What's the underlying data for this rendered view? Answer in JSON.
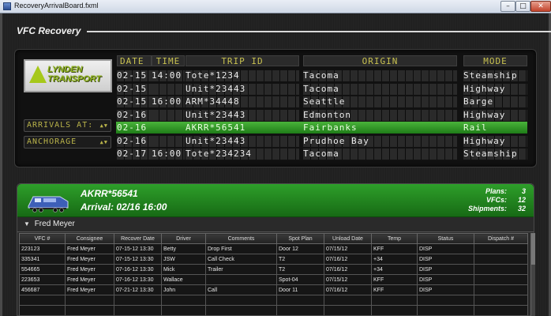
{
  "window": {
    "title": "RecoveryArrivalBoard.fxml",
    "minimize_glyph": "–",
    "maximize_glyph": "□",
    "close_glyph": "✕"
  },
  "app": {
    "title": "VFC Recovery"
  },
  "logo": {
    "line1": "LYNDEN",
    "line2": "TRANSPORT"
  },
  "selectors": {
    "mode_label": "ARRIVALS AT:",
    "location": "ANCHORAGE",
    "arrow_glyph": "▲▼"
  },
  "board": {
    "headers": {
      "date": "DATE",
      "time": "TIME",
      "trip": "TRIP ID",
      "origin": "ORIGIN",
      "mode": "MODE"
    },
    "selected_row_index": 4,
    "rows": [
      {
        "date": "02-15",
        "time": "14:00",
        "trip": "Tote*1234",
        "origin": "Tacoma",
        "mode": "Steamship"
      },
      {
        "date": "02-15",
        "time": "",
        "trip": "Unit*23443",
        "origin": "Tacoma",
        "mode": "Highway"
      },
      {
        "date": "02-15",
        "time": "16:00",
        "trip": "ARM*34448",
        "origin": "Seattle",
        "mode": "Barge"
      },
      {
        "date": "02-16",
        "time": "",
        "trip": "Unit*23443",
        "origin": "Edmonton",
        "mode": "Highway"
      },
      {
        "date": "02-16",
        "time": "",
        "trip": "AKRR*56541",
        "origin": "Fairbanks",
        "mode": "Rail"
      },
      {
        "date": "02-16",
        "time": "",
        "trip": "Unit*23443",
        "origin": "Prudhoe Bay",
        "mode": "Highway"
      },
      {
        "date": "02-17",
        "time": "16:00",
        "trip": "Tote*234234",
        "origin": "Tacoma",
        "mode": "Steamship"
      }
    ]
  },
  "detail": {
    "trip_id": "AKRR*56541",
    "arrival": "Arrival: 02/16 16:00",
    "stats": [
      {
        "label": "Plans:",
        "value": "3"
      },
      {
        "label": "VFCs:",
        "value": "12"
      },
      {
        "label": "Shipments:",
        "value": "32"
      }
    ],
    "group": "Fred Meyer",
    "group_toggle_glyph": "▼",
    "columns": [
      "VFC #",
      "Consignee",
      "Recover Date",
      "Driver",
      "Comments",
      "Spot Plan",
      "Unload Date",
      "Temp",
      "Status",
      "Dispatch #"
    ],
    "rows": [
      [
        "223123",
        "Fred Meyer",
        "07-15-12 13:30",
        "Betty",
        "Drop First",
        "Door 12",
        "07/15/12",
        "KFF",
        "DISP",
        ""
      ],
      [
        "335341",
        "Fred Meyer",
        "07-15-12 13:30",
        "JSW",
        "Call Check",
        "T2",
        "07/16/12",
        "+34",
        "DISP",
        ""
      ],
      [
        "554665",
        "Fred Meyer",
        "07-16-12 13:30",
        "Mick",
        "Trailer",
        "T2",
        "07/16/12",
        "+34",
        "DISP",
        ""
      ],
      [
        "223653",
        "Fred Meyer",
        "07-16-12 13:30",
        "Wallace",
        "",
        "Spot-04",
        "07/15/12",
        "KFF",
        "DISP",
        ""
      ],
      [
        "456687",
        "Fred Meyer",
        "07-21-12 13:30",
        "John",
        "Call",
        "Door 11",
        "07/16/12",
        "KFF",
        "DISP",
        ""
      ],
      [
        "",
        "",
        "",
        "",
        "",
        "",
        "",
        "",
        "",
        ""
      ],
      [
        "",
        "",
        "",
        "",
        "",
        "",
        "",
        "",
        "",
        ""
      ]
    ]
  },
  "colors": {
    "board_text": "#ededed",
    "board_header_text": "#c9c250",
    "highlight_green": "#2e9f2a",
    "logo_green": "#8fb321"
  }
}
